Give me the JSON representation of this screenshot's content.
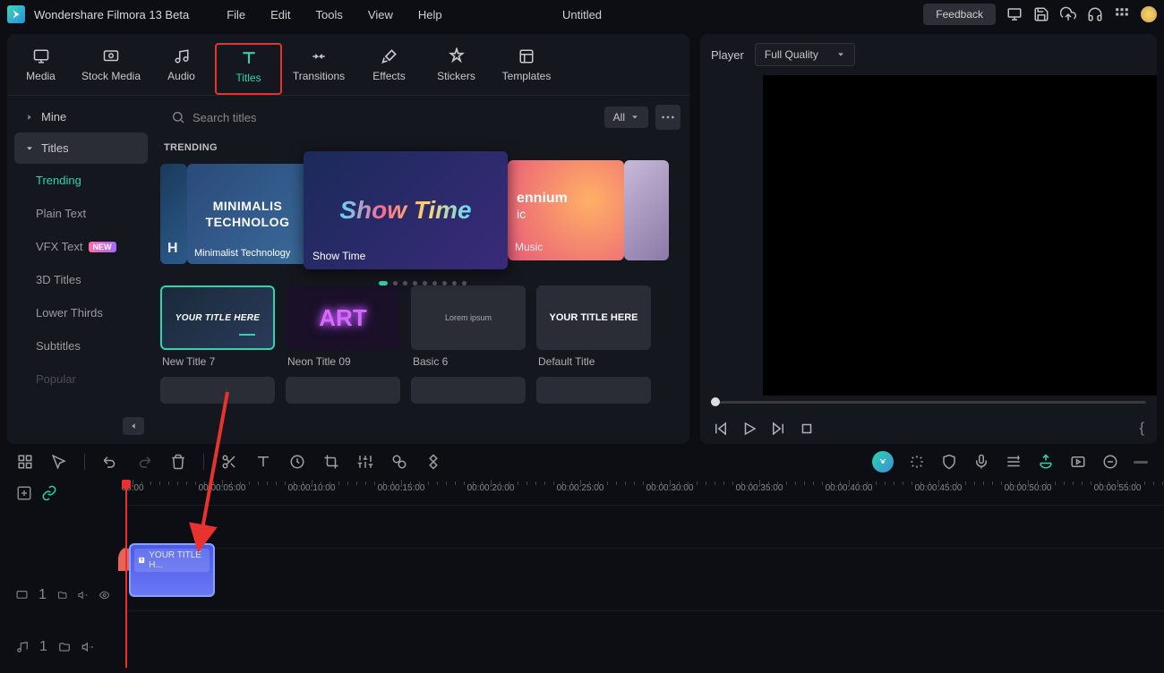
{
  "app": {
    "name": "Wondershare Filmora 13 Beta",
    "doc_title": "Untitled",
    "feedback": "Feedback"
  },
  "menus": [
    "File",
    "Edit",
    "Tools",
    "View",
    "Help"
  ],
  "tabs": [
    {
      "id": "media",
      "label": "Media"
    },
    {
      "id": "stock-media",
      "label": "Stock Media"
    },
    {
      "id": "audio",
      "label": "Audio"
    },
    {
      "id": "titles",
      "label": "Titles",
      "active": true,
      "highlighted": true
    },
    {
      "id": "transitions",
      "label": "Transitions"
    },
    {
      "id": "effects",
      "label": "Effects"
    },
    {
      "id": "stickers",
      "label": "Stickers"
    },
    {
      "id": "templates",
      "label": "Templates"
    }
  ],
  "sidebar": {
    "mine": "Mine",
    "titles": "Titles",
    "subs": [
      {
        "label": "Trending",
        "active": true
      },
      {
        "label": "Plain Text"
      },
      {
        "label": "VFX Text",
        "badge": "NEW"
      },
      {
        "label": "3D Titles"
      },
      {
        "label": "Lower Thirds"
      },
      {
        "label": "Subtitles"
      },
      {
        "label": "Popular"
      }
    ]
  },
  "search": {
    "placeholder": "Search titles",
    "filter_label": "All"
  },
  "trending": {
    "label": "TRENDING",
    "cards": {
      "hi": "H",
      "minimalist_title1": "MINIMALIS",
      "minimalist_title2": "TECHNOLOG",
      "minimalist_caption": "Minimalist Technology",
      "showtime_title": "Show Time",
      "showtime_caption": "Show Time",
      "ennium_t1": "ennium",
      "ennium_t2": "ic",
      "ennium_caption": "Music"
    }
  },
  "title_cards": [
    {
      "name": "New Title 7",
      "thumb_text": "YOUR TITLE HERE",
      "style": "yt",
      "selected": true
    },
    {
      "name": "Neon Title 09",
      "thumb_text": "ART",
      "style": "neon"
    },
    {
      "name": "Basic 6",
      "thumb_text": "Lorem ipsum",
      "style": "basic"
    },
    {
      "name": "Default Title",
      "thumb_text": "YOUR TITLE HERE",
      "style": "default"
    }
  ],
  "player": {
    "label": "Player",
    "quality": "Full Quality"
  },
  "timeline": {
    "marks": [
      "00:00",
      "00:00:05:00",
      "00:00:10:00",
      "00:00:15:00",
      "00:00:20:00",
      "00:00:25:00",
      "00:00:30:00",
      "00:00:35:00",
      "00:00:40:00",
      "00:00:45:00",
      "00:00:50:00",
      "00:00:55:00"
    ],
    "clip_label": "YOUR TITLE H...",
    "track_video": "1",
    "track_audio": "1"
  }
}
